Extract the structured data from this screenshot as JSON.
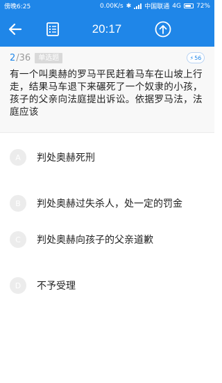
{
  "status_bar": {
    "time": "傍晚6:25",
    "network_speed": "0.00K/s",
    "carrier": "中国联通",
    "network_type": "4G",
    "battery": "72%"
  },
  "app_bar": {
    "timer": "20:17",
    "icons": [
      "back-arrow-icon",
      "answer-sheet-icon",
      "upload-icon"
    ]
  },
  "question": {
    "index": "2",
    "total": "/36",
    "type": "单选题",
    "like_count": "56",
    "text": "有一个叫奥赫的罗马平民赶着马车在山坡上行走，结果马车退下来碾死了一个奴隶的小孩，孩子的父亲向法庭提出诉讼。依据罗马法，法庭应该"
  },
  "options": [
    {
      "letter": "A",
      "text": "判处奥赫死刑"
    },
    {
      "letter": "B",
      "text": "判处奥赫过失杀人，处一定的罚金"
    },
    {
      "letter": "C",
      "text": "判处奥赫向孩子的父亲道歉"
    },
    {
      "letter": "D",
      "text": "不予受理"
    }
  ],
  "colors": {
    "primary": "#1f86e8",
    "option_circle": "#ececec"
  }
}
